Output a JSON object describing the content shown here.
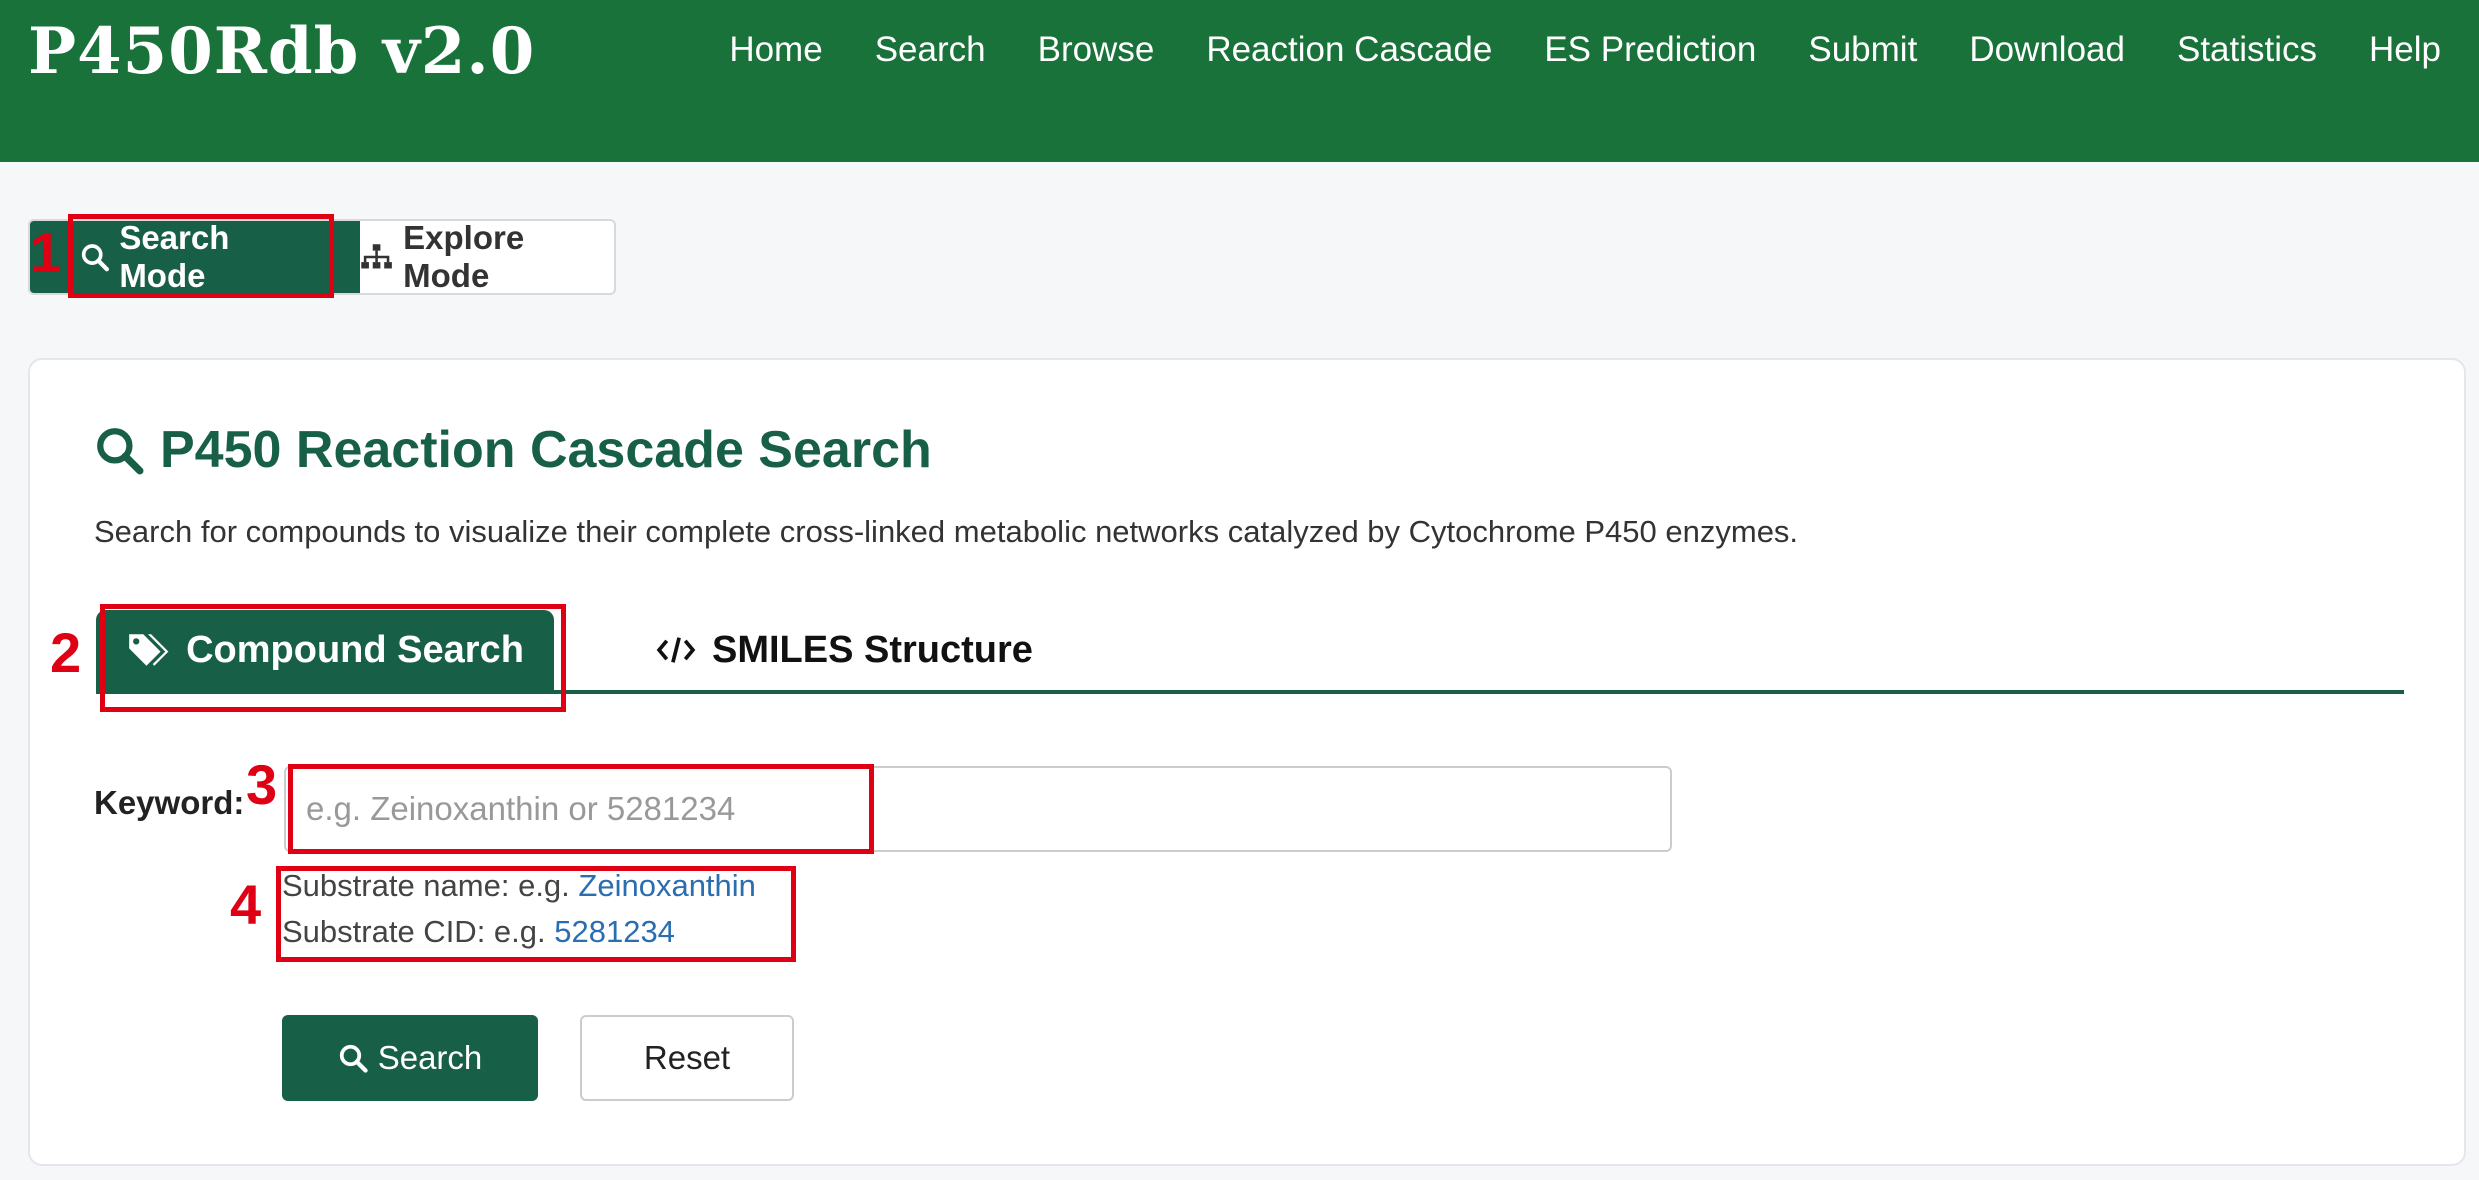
{
  "header": {
    "brand": "P450Rdb v2.0",
    "nav": [
      "Home",
      "Search",
      "Browse",
      "Reaction Cascade",
      "ES Prediction",
      "Submit",
      "Download",
      "Statistics",
      "Help"
    ]
  },
  "mode": {
    "search_label": "Search Mode",
    "explore_label": "Explore Mode",
    "active": "search"
  },
  "card": {
    "title": "P450 Reaction Cascade Search",
    "description": "Search for compounds to visualize their complete cross-linked metabolic networks catalyzed by Cytochrome P450 enzymes."
  },
  "tabs": {
    "compound": "Compound Search",
    "smiles": "SMILES Structure",
    "active": "compound"
  },
  "form": {
    "keyword_label": "Keyword:",
    "placeholder": "e.g. Zeinoxanthin or 5281234",
    "value": "",
    "hint_name_prefix": "Substrate name: e.g. ",
    "hint_name_example": "Zeinoxanthin",
    "hint_cid_prefix": "Substrate CID: e.g. ",
    "hint_cid_example": "5281234",
    "search_label": "Search",
    "reset_label": "Reset"
  },
  "annotations": [
    "1",
    "2",
    "3",
    "4"
  ],
  "colors": {
    "header_green": "#19723a",
    "primary_green": "#185f48",
    "annotation_red": "#e00014",
    "link_blue": "#2a6db0"
  }
}
